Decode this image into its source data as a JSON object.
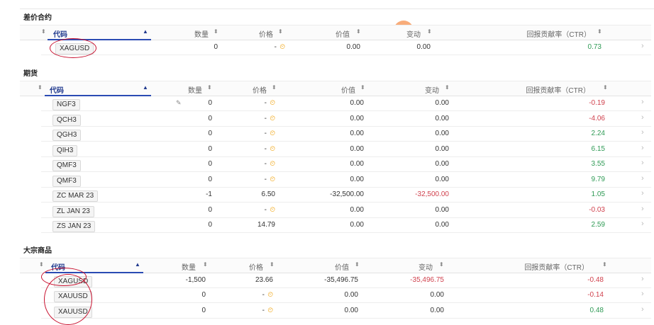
{
  "sections": [
    {
      "title": "差价合约",
      "headers": {
        "qty": "数量",
        "price": "价格",
        "value": "价值",
        "change": "变动",
        "ctr": "回报贡献率（CTR）",
        "code": "代码"
      },
      "rows": [
        {
          "code": "XAGUSD",
          "qty": "0",
          "price": "-",
          "price_clock": true,
          "value": "0.00",
          "change": "0.00",
          "change_neg": false,
          "ctr": "0.73",
          "ctr_sign": "pos"
        }
      ]
    },
    {
      "title": "期货",
      "headers": {
        "qty": "数量",
        "price": "价格",
        "value": "价值",
        "change": "变动",
        "ctr": "回报贡献率（CTR）",
        "code": "代码"
      },
      "rows": [
        {
          "code": "NGF3",
          "qty": "0",
          "price": "-",
          "price_clock": true,
          "value": "0.00",
          "change": "0.00",
          "change_neg": false,
          "ctr": "-0.19",
          "ctr_sign": "neg"
        },
        {
          "code": "QCH3",
          "qty": "0",
          "price": "-",
          "price_clock": true,
          "value": "0.00",
          "change": "0.00",
          "change_neg": false,
          "ctr": "-4.06",
          "ctr_sign": "neg"
        },
        {
          "code": "QGH3",
          "qty": "0",
          "price": "-",
          "price_clock": true,
          "value": "0.00",
          "change": "0.00",
          "change_neg": false,
          "ctr": "2.24",
          "ctr_sign": "pos"
        },
        {
          "code": "QIH3",
          "qty": "0",
          "price": "-",
          "price_clock": true,
          "value": "0.00",
          "change": "0.00",
          "change_neg": false,
          "ctr": "6.15",
          "ctr_sign": "pos"
        },
        {
          "code": "QMF3",
          "qty": "0",
          "price": "-",
          "price_clock": true,
          "value": "0.00",
          "change": "0.00",
          "change_neg": false,
          "ctr": "3.55",
          "ctr_sign": "pos"
        },
        {
          "code": "QMF3",
          "qty": "0",
          "price": "-",
          "price_clock": true,
          "value": "0.00",
          "change": "0.00",
          "change_neg": false,
          "ctr": "9.79",
          "ctr_sign": "pos"
        },
        {
          "code": "ZC MAR 23",
          "qty": "-1",
          "price": "6.50",
          "price_clock": false,
          "value": "-32,500.00",
          "change": "-32,500.00",
          "change_neg": true,
          "ctr": "1.05",
          "ctr_sign": "pos"
        },
        {
          "code": "ZL JAN 23",
          "qty": "0",
          "price": "-",
          "price_clock": true,
          "value": "0.00",
          "change": "0.00",
          "change_neg": false,
          "ctr": "-0.03",
          "ctr_sign": "neg"
        },
        {
          "code": "ZS JAN 23",
          "qty": "0",
          "price": "14.79",
          "price_clock": false,
          "value": "0.00",
          "change": "0.00",
          "change_neg": false,
          "ctr": "2.59",
          "ctr_sign": "pos"
        }
      ]
    },
    {
      "title": "大宗商品",
      "headers": {
        "qty": "数量",
        "price": "价格",
        "value": "价值",
        "change": "变动",
        "ctr": "回报贡献率（CTR）",
        "code": "代码"
      },
      "rows": [
        {
          "code": "XAGUSD",
          "qty": "-1,500",
          "price": "23.66",
          "price_clock": false,
          "value": "-35,496.75",
          "change": "-35,496.75",
          "change_neg": true,
          "ctr": "-0.48",
          "ctr_sign": "neg"
        },
        {
          "code": "XAUUSD",
          "qty": "0",
          "price": "-",
          "price_clock": true,
          "value": "0.00",
          "change": "0.00",
          "change_neg": false,
          "ctr": "-0.14",
          "ctr_sign": "neg"
        },
        {
          "code": "XAUUSD",
          "qty": "0",
          "price": "-",
          "price_clock": true,
          "value": "0.00",
          "change": "0.00",
          "change_neg": false,
          "ctr": "0.48",
          "ctr_sign": "pos"
        }
      ]
    }
  ],
  "icons": {
    "sort": "sort-arrows-icon",
    "sort_up": "sort-up-icon",
    "clock": "clock-icon",
    "row_chevron": "chevron-right-icon"
  },
  "colors": {
    "negative": "#d0414d",
    "positive": "#2f9a55",
    "clock": "#f0a20b",
    "code_header": "#223b8f"
  }
}
